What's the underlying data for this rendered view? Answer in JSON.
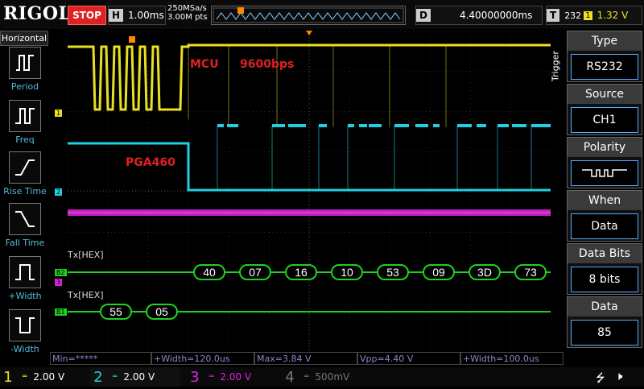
{
  "brand": "RIGOL",
  "run_state": "STOP",
  "horizontal": {
    "key": "H",
    "timebase": "1.00ms",
    "sample_rate": "250MSa/s",
    "points": "3.00M pts"
  },
  "delay": {
    "key": "D",
    "value": "4.40000000ms"
  },
  "trigger_top": {
    "key": "T",
    "code": "232",
    "channel": "1",
    "level": "1.32 V"
  },
  "left_menu": {
    "title": "Horizontal",
    "items": [
      {
        "label": "Period"
      },
      {
        "label": "Freq"
      },
      {
        "label": "Rise Time"
      },
      {
        "label": "Fall Time"
      },
      {
        "label": "+Width"
      },
      {
        "label": "-Width"
      }
    ]
  },
  "trigger_menu": {
    "side_label": "Trigger",
    "blocks": [
      {
        "title": "Type",
        "value": "RS232"
      },
      {
        "title": "Source",
        "value": "CH1"
      },
      {
        "title": "Polarity",
        "value": ""
      },
      {
        "title": "When",
        "value": "Data"
      },
      {
        "title": "Data Bits",
        "value": "8 bits"
      },
      {
        "title": "Data",
        "value": "85"
      }
    ]
  },
  "annotations": {
    "mcu": "MCU",
    "baud": "9600bps",
    "pga": "PGA460"
  },
  "channel_markers": {
    "ch1": "1",
    "ch2": "2",
    "ch3": "3",
    "b1": "B1",
    "b2": "B2"
  },
  "decode": {
    "bus2_label": "Tx[HEX]",
    "bus2_values": [
      "40",
      "07",
      "16",
      "10",
      "53",
      "09",
      "3D",
      "73"
    ],
    "bus1_label": "Tx[HEX]",
    "bus1_values": [
      "55",
      "05"
    ]
  },
  "measurements": [
    {
      "text": "Min=*****"
    },
    {
      "text": "+Width=120.0us"
    },
    {
      "text": "Max=3.84 V"
    },
    {
      "text": "Vpp=4.40 V"
    },
    {
      "text": "+Width=100.0us"
    }
  ],
  "channels_bottom": [
    {
      "num": "1",
      "scale": "2.00 V",
      "color": "#f0e020"
    },
    {
      "num": "2",
      "scale": "2.00 V",
      "color": "#20d0e0"
    },
    {
      "num": "3",
      "scale": "2.00 V",
      "color": "#e020e0"
    },
    {
      "num": "4",
      "scale": "500mV",
      "color": "#666666"
    }
  ],
  "colors": {
    "ch1": "#e8e020",
    "ch2": "#20d0e0",
    "ch3": "#d020d0",
    "bus": "#20d020",
    "accent_red": "#e02020"
  }
}
